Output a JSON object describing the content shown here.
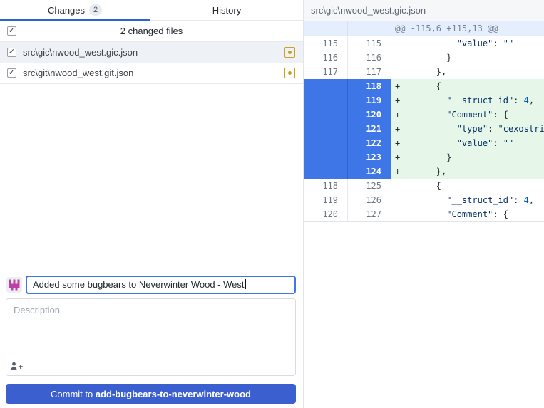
{
  "left_panel": {
    "tabs": [
      {
        "label": "Changes",
        "badge": "2",
        "active": true
      },
      {
        "label": "History",
        "active": false
      }
    ],
    "files_header": {
      "label": "2 changed files",
      "checked": true
    },
    "files": [
      {
        "path": "src\\gic\\nwood_west.gic.json",
        "status": "modified",
        "checked": true,
        "selected": true
      },
      {
        "path": "src\\git\\nwood_west.git.json",
        "status": "modified",
        "checked": true,
        "selected": false
      }
    ],
    "commit": {
      "summary_value": "Added some bugbears to Neverwinter Wood - West",
      "description_placeholder": "Description",
      "button_prefix": "Commit to ",
      "branch": "add-bugbears-to-neverwinter-wood"
    }
  },
  "diff_panel": {
    "file_header": "src\\gic\\nwood_west.gic.json",
    "rows": [
      {
        "old": "",
        "new": "",
        "type": "hunk",
        "selected": false,
        "text": "@@ -115,6 +115,13 @@"
      },
      {
        "old": "115",
        "new": "115",
        "type": "context",
        "selected": false,
        "text": "            \"value\": \"\""
      },
      {
        "old": "116",
        "new": "116",
        "type": "context",
        "selected": false,
        "text": "          }"
      },
      {
        "old": "117",
        "new": "117",
        "type": "context",
        "selected": false,
        "text": "        },"
      },
      {
        "old": "",
        "new": "118",
        "type": "added",
        "selected": true,
        "text": "+       {"
      },
      {
        "old": "",
        "new": "119",
        "type": "added",
        "selected": true,
        "text": "+         \"__struct_id\": 4,"
      },
      {
        "old": "",
        "new": "120",
        "type": "added",
        "selected": true,
        "text": "+         \"Comment\": {"
      },
      {
        "old": "",
        "new": "121",
        "type": "added",
        "selected": true,
        "text": "+           \"type\": \"cexostring\","
      },
      {
        "old": "",
        "new": "122",
        "type": "added",
        "selected": true,
        "text": "+           \"value\": \"\""
      },
      {
        "old": "",
        "new": "123",
        "type": "added",
        "selected": true,
        "text": "+         }"
      },
      {
        "old": "",
        "new": "124",
        "type": "added",
        "selected": true,
        "text": "+       },"
      },
      {
        "old": "118",
        "new": "125",
        "type": "context",
        "selected": false,
        "text": "        {"
      },
      {
        "old": "119",
        "new": "126",
        "type": "context",
        "selected": false,
        "text": "          \"__struct_id\": 4,"
      },
      {
        "old": "120",
        "new": "127",
        "type": "context",
        "selected": false,
        "text": "          \"Comment\": {"
      }
    ]
  },
  "colors": {
    "tab_underline": "#2c62d4",
    "selected_gutter": "#3e76e8",
    "gutter_divider": "#2f63cf",
    "commit_button": "#3b5fce",
    "focus_border": "#3e76e8",
    "added_bg": "#e6f7e9",
    "hunk_bg": "#e4eefc",
    "modified_icon": "#c9a11e",
    "avatar": "#bf3fa4",
    "badge_bg": "#e9ebee",
    "badge_text": "#4a5a73"
  }
}
